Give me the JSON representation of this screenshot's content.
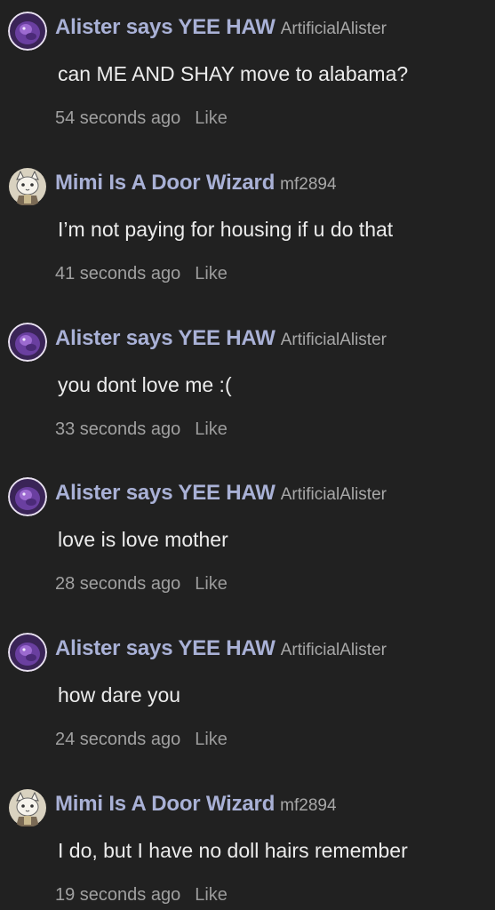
{
  "colors": {
    "background": "#212121",
    "display_name": "#a9b1d6",
    "username": "#a8a8a8",
    "text": "#ececec",
    "meta": "#a0a0a0"
  },
  "comments": [
    {
      "avatar_icon": "purple-creature-avatar-icon",
      "display_name": "Alister says YEE HAW",
      "username": "ArtificialAlister",
      "text": "can ME AND SHAY move to alabama?",
      "time": "54 seconds ago",
      "like_label": "Like"
    },
    {
      "avatar_icon": "cat-avatar-icon",
      "display_name": "Mimi Is A Door Wizard",
      "username": "mf2894",
      "text": "I’m not paying for housing if u do that",
      "time": "41 seconds ago",
      "like_label": "Like"
    },
    {
      "avatar_icon": "purple-creature-avatar-icon",
      "display_name": "Alister says YEE HAW",
      "username": "ArtificialAlister",
      "text": "you dont love me :(",
      "time": "33 seconds ago",
      "like_label": "Like"
    },
    {
      "avatar_icon": "purple-creature-avatar-icon",
      "display_name": "Alister says YEE HAW",
      "username": "ArtificialAlister",
      "text": "love is love mother",
      "time": "28 seconds ago",
      "like_label": "Like"
    },
    {
      "avatar_icon": "purple-creature-avatar-icon",
      "display_name": "Alister says YEE HAW",
      "username": "ArtificialAlister",
      "text": "how dare you",
      "time": "24 seconds ago",
      "like_label": "Like"
    },
    {
      "avatar_icon": "cat-avatar-icon",
      "display_name": "Mimi Is A Door Wizard",
      "username": "mf2894",
      "text": "I do, but I have no doll hairs remember",
      "time": "19 seconds ago",
      "like_label": "Like"
    }
  ]
}
